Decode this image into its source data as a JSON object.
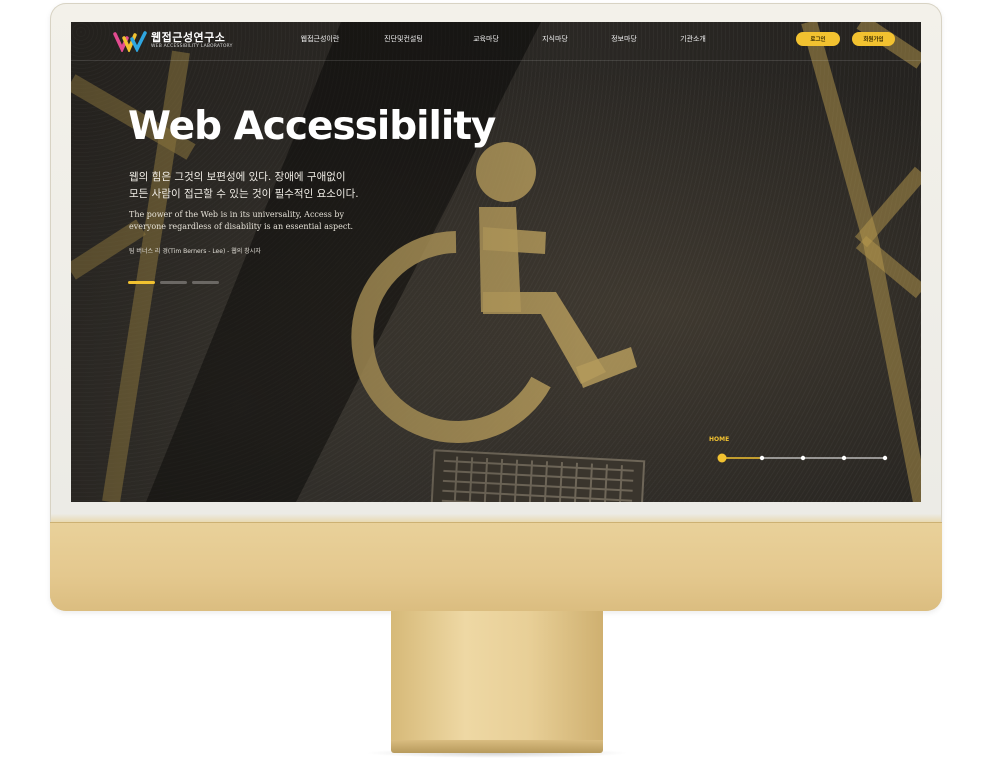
{
  "header": {
    "logo_title": "웹접근성연구소",
    "logo_subtitle": "WEB ACCESSIBILITY LABORATORY",
    "nav": [
      "웹접근성이란",
      "진단및컨설팅",
      "교육마당",
      "지식마당",
      "정보마당",
      "기관소개"
    ],
    "login_label": "로그인",
    "join_label": "회원가입"
  },
  "hero": {
    "title": "Web Accessibility",
    "quote_ko_line1": "웹의 힘은 그것의 보편성에 있다. 장애에 구애없이",
    "quote_ko_line2": "모든 사람이 접근할 수 있는 것이 필수적인 요소이다.",
    "quote_en": "The power of the Web is in its universality, Access by everyone regardless of disability is an essential aspect.",
    "author": "팀 버너스 리 경(Tim Berners - Lee) - 웹의 창시자"
  },
  "slider": {
    "active_index": 0,
    "count": 3
  },
  "timeline": {
    "label": "HOME",
    "active_index": 0,
    "count": 5
  },
  "colors": {
    "accent": "#f2c230",
    "monitor_gold": "#e4c88e",
    "screen_dark": "#2e2b27"
  }
}
